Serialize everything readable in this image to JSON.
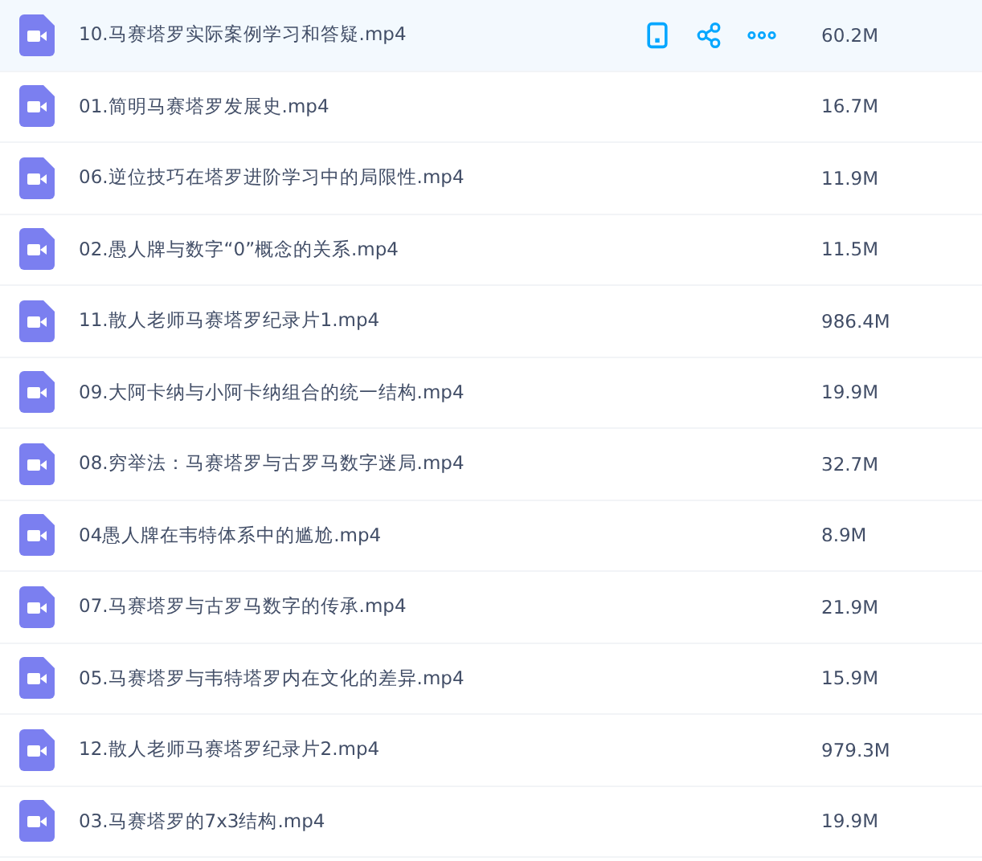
{
  "files": [
    {
      "name": "10.马赛塔罗实际案例学习和答疑.mp4",
      "size": "60.2M",
      "hovered": true
    },
    {
      "name": "01.简明马赛塔罗发展史.mp4",
      "size": "16.7M",
      "hovered": false
    },
    {
      "name": "06.逆位技巧在塔罗进阶学习中的局限性.mp4",
      "size": "11.9M",
      "hovered": false
    },
    {
      "name": "02.愚人牌与数字“0”概念的关系.mp4",
      "size": "11.5M",
      "hovered": false
    },
    {
      "name": "11.散人老师马赛塔罗纪录片1.mp4",
      "size": "986.4M",
      "hovered": false
    },
    {
      "name": "09.大阿卡纳与小阿卡纳组合的统一结构.mp4",
      "size": "19.9M",
      "hovered": false
    },
    {
      "name": "08.穷举法：马赛塔罗与古罗马数字迷局.mp4",
      "size": "32.7M",
      "hovered": false
    },
    {
      "name": "04愚人牌在韦特体系中的尴尬.mp4",
      "size": "8.9M",
      "hovered": false
    },
    {
      "name": "07.马赛塔罗与古罗马数字的传承.mp4",
      "size": "21.9M",
      "hovered": false
    },
    {
      "name": "05.马赛塔罗与韦特塔罗内在文化的差异.mp4",
      "size": "15.9M",
      "hovered": false
    },
    {
      "name": "12.散人老师马赛塔罗纪录片2.mp4",
      "size": "979.3M",
      "hovered": false
    },
    {
      "name": "03.马赛塔罗的7x3结构.mp4",
      "size": "19.9M",
      "hovered": false
    }
  ]
}
